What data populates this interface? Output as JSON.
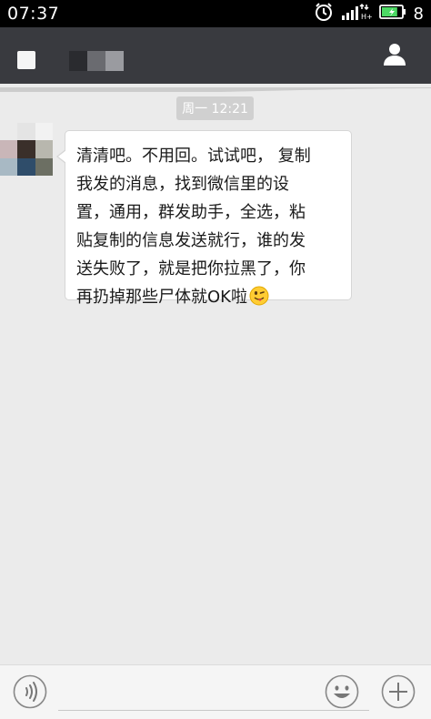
{
  "status_bar": {
    "time": "07:37",
    "battery_level_text": "8",
    "battery_fill_fraction": 0.8,
    "icons": [
      "alarm-icon",
      "signal-icon",
      "battery-icon"
    ]
  },
  "title_bar": {
    "icons": [
      "back-icon",
      "profile-icon"
    ]
  },
  "chat": {
    "timestamp": "周一 12:21",
    "message": {
      "lines": [
        "清清吧。不用回。试试吧， 复制",
        "我发的消息，找到微信里的设",
        "置，通用，群发助手，全选，粘",
        "贴复制的信息发送就行，谁的发",
        "送失败了，就是把你拉黑了，你",
        "再扔掉那些尸体就OK啦"
      ],
      "emoji": "winking-tongue-emoji"
    }
  },
  "input_bar": {
    "value": "",
    "icons": [
      "voice-icon",
      "emoji-icon",
      "plus-icon"
    ]
  },
  "colors": {
    "status_bar_bg": "#000000",
    "title_bar_bg": "#393a3f",
    "chat_bg": "#ebebeb",
    "bubble_bg": "#ffffff",
    "timestamp_pill": "#d0d0d0",
    "battery_green": "#4cd964"
  }
}
